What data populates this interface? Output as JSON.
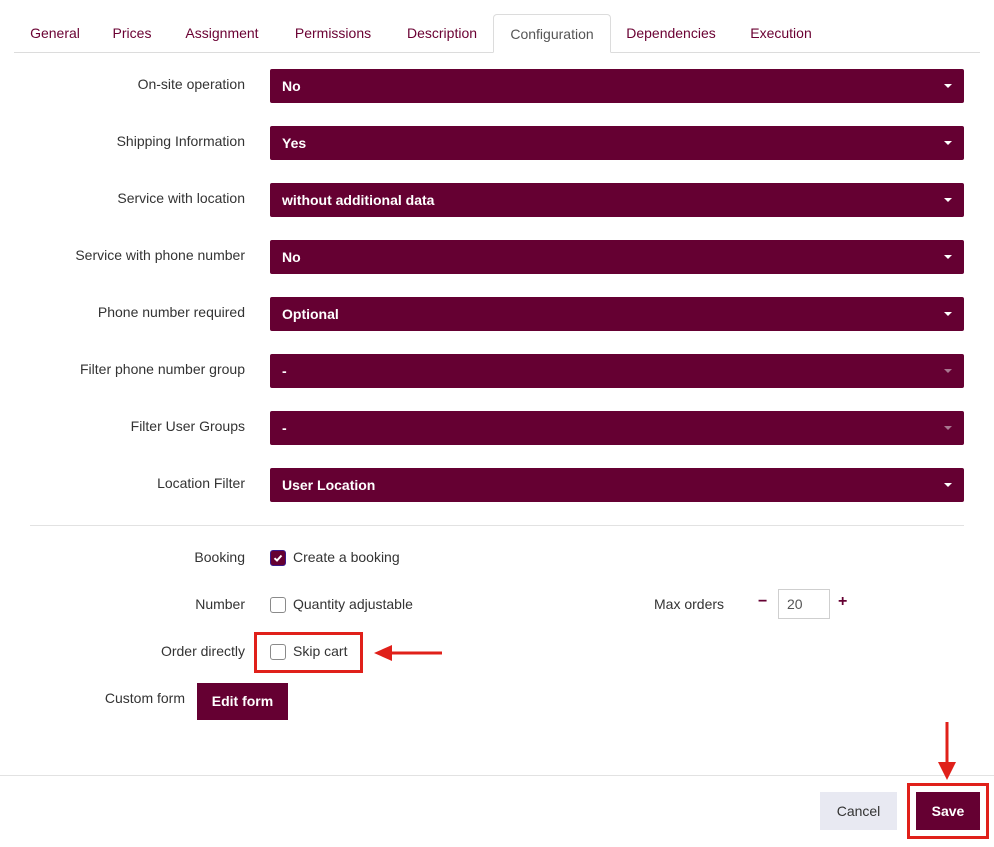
{
  "tabs": [
    {
      "label": "General"
    },
    {
      "label": "Prices"
    },
    {
      "label": "Assignment"
    },
    {
      "label": "Permissions"
    },
    {
      "label": "Description"
    },
    {
      "label": "Configuration",
      "active": true
    },
    {
      "label": "Dependencies"
    },
    {
      "label": "Execution"
    }
  ],
  "config": {
    "on_site_operation": {
      "label": "On-site operation",
      "value": "No"
    },
    "shipping_information": {
      "label": "Shipping Information",
      "value": "Yes"
    },
    "service_with_location": {
      "label": "Service with location",
      "value": "without additional data"
    },
    "service_with_phone": {
      "label": "Service with phone number",
      "value": "No"
    },
    "phone_required": {
      "label": "Phone number required",
      "value": "Optional"
    },
    "filter_phone_group": {
      "label": "Filter phone number group",
      "value": "-"
    },
    "filter_user_groups": {
      "label": "Filter User Groups",
      "value": "-"
    },
    "location_filter": {
      "label": "Location Filter",
      "value": "User Location"
    }
  },
  "booking": {
    "label": "Booking",
    "checkbox_label": "Create a booking",
    "checked": true
  },
  "number": {
    "label": "Number",
    "checkbox_label": "Quantity adjustable",
    "checked": false
  },
  "max_orders": {
    "label": "Max orders",
    "value": "20",
    "minus": "−",
    "plus": "+"
  },
  "order_directly": {
    "label": "Order directly",
    "checkbox_label": "Skip cart",
    "checked": false
  },
  "custom_form": {
    "label": "Custom form",
    "button": "Edit form"
  },
  "footer": {
    "cancel": "Cancel",
    "save": "Save"
  },
  "colors": {
    "primary": "#650032",
    "annotation": "#e0201a"
  }
}
